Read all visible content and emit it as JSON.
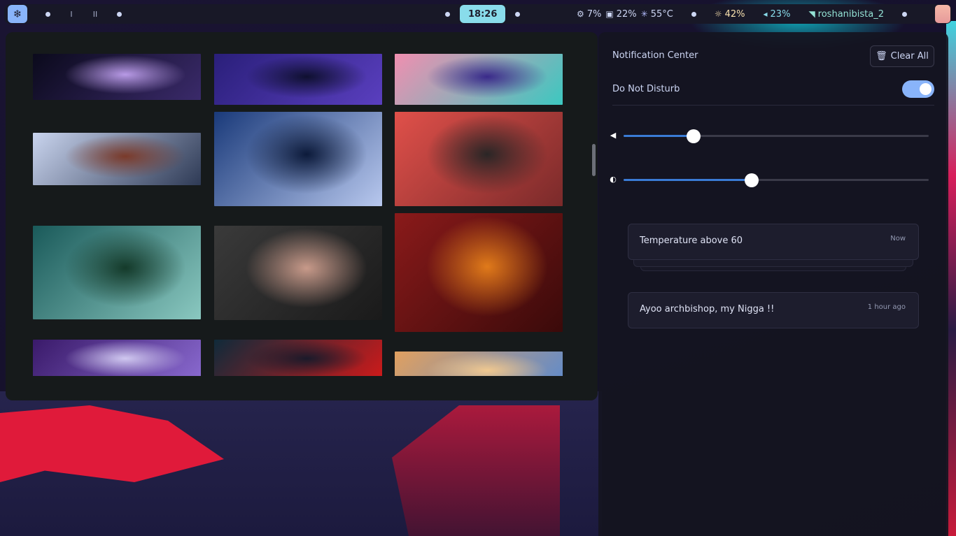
{
  "topbar": {
    "launcher_icon": "snowflake-icon",
    "launcher_glyph": "❄",
    "workspaces": [
      "",
      "I",
      "II",
      ""
    ],
    "clock": "18:26",
    "cpu": "7%",
    "memory": "22%",
    "temperature": "55°C",
    "brightness": "42%",
    "volume": "23%",
    "network": "roshanibista_2",
    "colors": {
      "bar_bg": "#181827",
      "launcher_bg": "#89b4fa",
      "clock_bg": "#89dceb",
      "brightness_fg": "#f9e2af",
      "volume_fg": "#89dceb",
      "network_fg": "#94e2d5"
    }
  },
  "wallpaper_picker": {
    "thumbnails": [
      {
        "name": "galaxy-wallpaper",
        "colors": [
          "#0b0a1c",
          "#3a2a6a",
          "#b89ae6"
        ]
      },
      {
        "name": "anime-swordswoman-wallpaper",
        "colors": [
          "#2a1f7a",
          "#5a3fbf",
          "#0f1030"
        ]
      },
      {
        "name": "anime-flower-goddess-wallpaper",
        "colors": [
          "#f08fb0",
          "#3cc8c0",
          "#3a2a8a"
        ]
      },
      {
        "name": "moon-cliff-wallpaper",
        "colors": [
          "#c9d4ee",
          "#2e3a55",
          "#7a3a2a"
        ]
      },
      {
        "name": "white-haired-girl-wallpaper",
        "colors": [
          "#1a3a7a",
          "#b8c8ee",
          "#0c1a3a"
        ]
      },
      {
        "name": "red-sky-pagoda-wallpaper",
        "colors": [
          "#e0504a",
          "#7a2a2a",
          "#2a2626"
        ]
      },
      {
        "name": "lily-pads-wallpaper",
        "colors": [
          "#1a5a5a",
          "#8ac8c0",
          "#143a2a"
        ]
      },
      {
        "name": "dark-haired-girl-wallpaper",
        "colors": [
          "#3a3a3a",
          "#1a1a1a",
          "#c89a8a"
        ]
      },
      {
        "name": "eclipse-warrior-wallpaper",
        "colors": [
          "#8a1a1a",
          "#3a0a0a",
          "#e07a1a"
        ]
      },
      {
        "name": "purple-wings-wallpaper",
        "colors": [
          "#3a1a6a",
          "#8a6ad0",
          "#d0c8f0"
        ]
      },
      {
        "name": "red-figure-wallpaper",
        "colors": [
          "#0f2a3a",
          "#d01a1a",
          "#1a1a2a"
        ]
      },
      {
        "name": "sunset-sky-wallpaper",
        "colors": [
          "#e0a060",
          "#5a8ad0",
          "#f0c890"
        ]
      }
    ]
  },
  "notification_center": {
    "title": "Notification Center",
    "clear_all": "Clear All",
    "dnd_label": "Do Not Disturb",
    "dnd_enabled": true,
    "volume_level": 0.23,
    "brightness_level": 0.42,
    "notifications": [
      {
        "title": "Temperature above 60",
        "time": "Now"
      },
      {
        "title": "Ayoo archbishop, my Nigga !!",
        "time": "1 hour ago"
      }
    ]
  }
}
